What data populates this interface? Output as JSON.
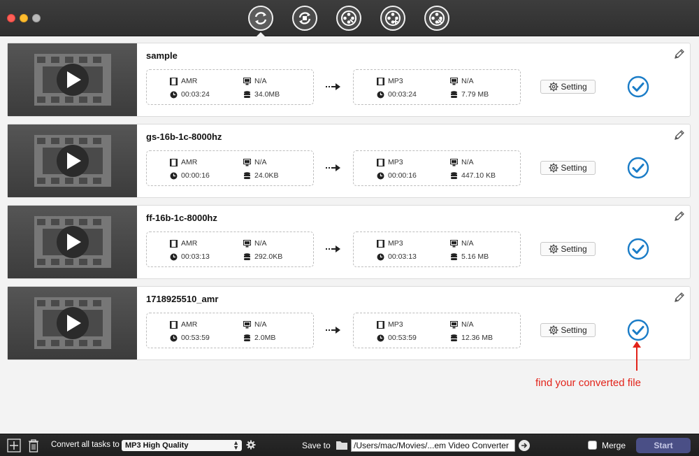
{
  "toolbar": {
    "tools": [
      {
        "name": "convert-tool",
        "icon": "convert-icon",
        "active": true
      },
      {
        "name": "rotate-tool",
        "icon": "rotate-icon",
        "active": false
      },
      {
        "name": "edit-tool",
        "icon": "film-reel-icon",
        "active": false
      },
      {
        "name": "merge-tool",
        "icon": "film-reel-plus-icon",
        "active": false
      },
      {
        "name": "compress-tool",
        "icon": "film-reel-tools-icon",
        "active": false
      }
    ]
  },
  "tasks": [
    {
      "title": "sample",
      "source": {
        "format": "AMR",
        "resolution": "N/A",
        "duration": "00:03:24",
        "size": "34.0MB"
      },
      "target": {
        "format": "MP3",
        "resolution": "N/A",
        "duration": "00:03:24",
        "size": "7.79 MB"
      },
      "setting_label": "Setting"
    },
    {
      "title": "gs-16b-1c-8000hz",
      "source": {
        "format": "AMR",
        "resolution": "N/A",
        "duration": "00:00:16",
        "size": "24.0KB"
      },
      "target": {
        "format": "MP3",
        "resolution": "N/A",
        "duration": "00:00:16",
        "size": "447.10 KB"
      },
      "setting_label": "Setting"
    },
    {
      "title": "ff-16b-1c-8000hz",
      "source": {
        "format": "AMR",
        "resolution": "N/A",
        "duration": "00:03:13",
        "size": "292.0KB"
      },
      "target": {
        "format": "MP3",
        "resolution": "N/A",
        "duration": "00:03:13",
        "size": "5.16 MB"
      },
      "setting_label": "Setting"
    },
    {
      "title": "1718925510_amr",
      "source": {
        "format": "AMR",
        "resolution": "N/A",
        "duration": "00:53:59",
        "size": "2.0MB"
      },
      "target": {
        "format": "MP3",
        "resolution": "N/A",
        "duration": "00:53:59",
        "size": "12.36 MB"
      },
      "setting_label": "Setting"
    }
  ],
  "annotation": {
    "text": "find your converted file",
    "color": "#e2231a"
  },
  "bottom": {
    "convert_all_label": "Convert all tasks to",
    "preset_value": "MP3 High Quality",
    "save_to_label": "Save to",
    "save_path": "/Users/mac/Movies/...em Video Converter",
    "merge_label": "Merge",
    "merge_checked": false,
    "start_label": "Start"
  },
  "colors": {
    "check": "#1a7cc7",
    "accent_start": "#4a4f86",
    "titlebar": "#3a3a3a"
  }
}
